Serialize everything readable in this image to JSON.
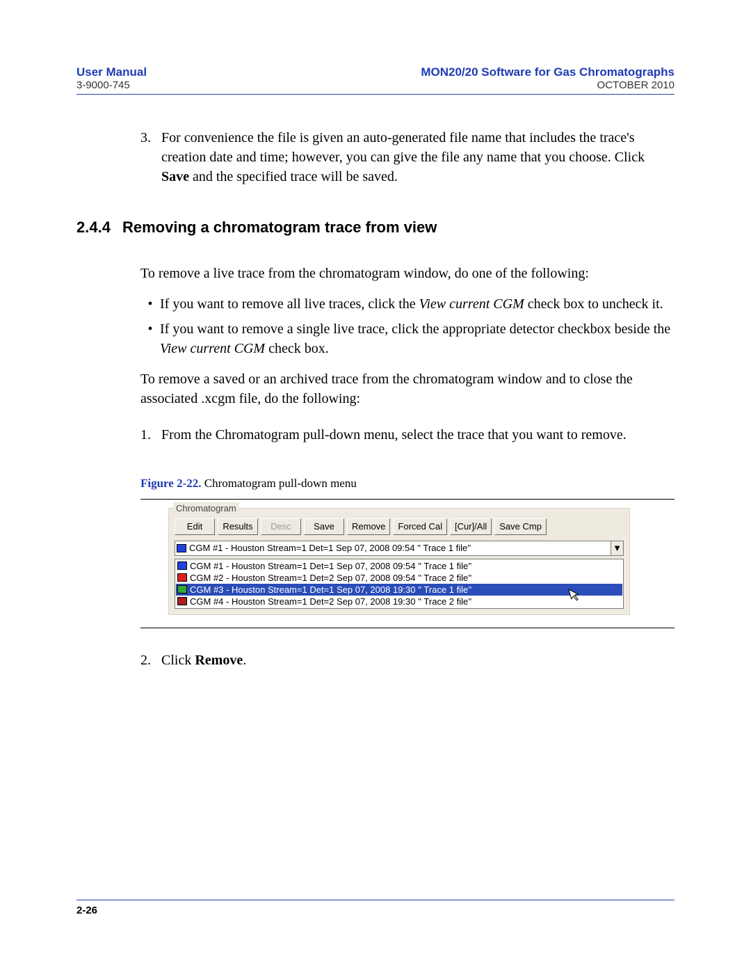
{
  "header": {
    "left_title": "User Manual",
    "right_title": "MON20/20 Software for Gas Chromatographs",
    "left_sub": "3-9000-745",
    "right_sub": "OCTOBER 2010"
  },
  "step3": {
    "num": "3.",
    "pre": "For convenience the file is given an auto-generated file name that includes the trace's creation date and time; however, you can give the file any name that you choose.  Click ",
    "bold": "Save",
    "post": " and the specified trace will be saved."
  },
  "section": {
    "num": "2.4.4",
    "title": "Removing a chromatogram trace from view"
  },
  "para_intro": "To remove a live trace from the chromatogram window, do one of the following:",
  "bullets": [
    {
      "pre": "If you want to remove all live traces, click the ",
      "ital": "View current CGM",
      "post": " check box to uncheck it."
    },
    {
      "pre": "If you want to remove a single live trace, click the appropriate detector checkbox beside the ",
      "ital": "View current CGM",
      "post": " check box."
    }
  ],
  "para_saved": "To remove a saved or an archived trace from the chromatogram window and to close the associated .xcgm file, do the following:",
  "numstep1": {
    "num": "1.",
    "text": "From the Chromatogram pull-down menu, select the trace that you want to remove."
  },
  "figure": {
    "label": "Figure 2-22.",
    "caption": "  Chromatogram pull-down menu"
  },
  "shot": {
    "group": "Chromatogram",
    "buttons": [
      "Edit",
      "Results",
      "Desc",
      "Save",
      "Remove",
      "Forced Cal",
      "[Cur]/All",
      "Save Cmp"
    ],
    "selected": "CGM #1 - Houston Stream=1 Det=1 Sep 07, 2008 09:54 '' Trace 1 file''",
    "items": [
      {
        "color": "#2044dd",
        "text": "CGM #1 - Houston Stream=1 Det=1 Sep 07, 2008 09:54 '' Trace 1 file''",
        "selected": false
      },
      {
        "color": "#dd2222",
        "text": "CGM #2 - Houston Stream=1 Det=2 Sep 07, 2008 09:54 '' Trace 2 file''",
        "selected": false
      },
      {
        "color": "#33aa33",
        "text": "CGM #3 - Houston Stream=1 Det=1 Sep 07, 2008 19:30 '' Trace 1 file''",
        "selected": true
      },
      {
        "color": "#aa1e1e",
        "text": "CGM #4 - Houston Stream=1 Det=2 Sep 07, 2008 19:30 '' Trace 2 file''",
        "selected": false
      }
    ]
  },
  "numstep2": {
    "num": "2.",
    "pre": "Click ",
    "bold": "Remove",
    "post": "."
  },
  "footer": {
    "page": "2-26"
  }
}
